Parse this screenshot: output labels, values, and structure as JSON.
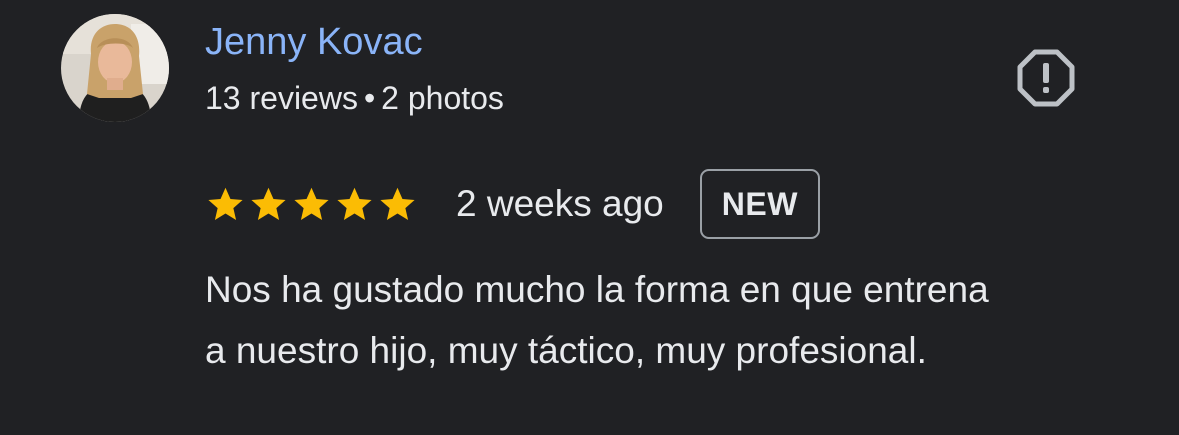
{
  "review": {
    "author_name": "Jenny Kovac",
    "review_count": "13 reviews",
    "separator": "•",
    "photo_count": "2 photos",
    "rating": 5,
    "max_rating": 5,
    "time_ago": "2 weeks ago",
    "badge": "NEW",
    "text_lines": [
      "Nos ha gustado mucho la forma en que entrena",
      "a nuestro hijo, muy táctico, muy profesional."
    ]
  },
  "icons": {
    "report": "report-octagon-icon",
    "star": "star-icon"
  },
  "colors": {
    "background": "#202124",
    "author_name": "#8ab4f8",
    "text": "#e8eaed",
    "star": "#fbbc04",
    "badge_border": "#9aa0a6",
    "report_icon": "#bdc1c6"
  }
}
